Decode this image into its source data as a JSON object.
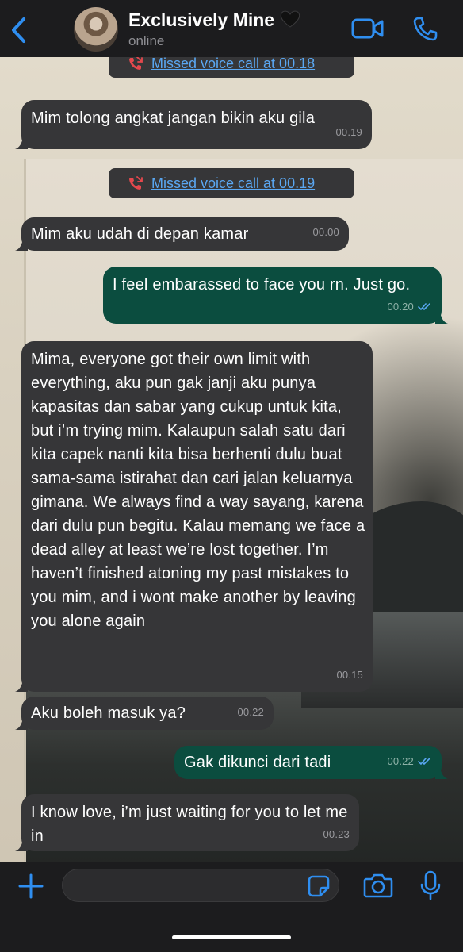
{
  "header": {
    "contact_name": "Exclusively Mine",
    "status": "online"
  },
  "messages": [
    {
      "type": "system",
      "text": "Missed voice call at 00.18"
    },
    {
      "type": "incoming",
      "text": "Mim tolong angkat jangan bikin aku gila",
      "time": "00.19"
    },
    {
      "type": "system",
      "text": "Missed voice call at 00.19"
    },
    {
      "type": "incoming",
      "text": "Mim aku udah di depan kamar",
      "time": "00.00"
    },
    {
      "type": "outgoing",
      "text": "I feel embarassed to face you rn. Just go.",
      "time": "00.20",
      "status": "read"
    },
    {
      "type": "incoming",
      "text": "Mima, everyone got their own limit with everything, aku pun gak janji aku punya kapasitas dan sabar yang cukup untuk kita, but i’m trying mim. Kalaupun salah satu dari kita capek nanti kita bisa berhenti dulu buat sama-sama istirahat dan cari jalan keluarnya gimana. We always find a way sayang, karena dari dulu pun begitu. Kalau memang we face a dead alley at least we’re lost together. I’m haven’t finished atoning my past mistakes to you mim, and i wont make another by leaving you alone again",
      "time": "00.15"
    },
    {
      "type": "incoming",
      "text": "Aku boleh masuk ya?",
      "time": "00.22"
    },
    {
      "type": "outgoing",
      "text": "Gak dikunci dari tadi",
      "time": "00.22",
      "status": "read"
    },
    {
      "type": "incoming",
      "text": "I know love, i’m just waiting for you to let me in",
      "time": "00.23"
    }
  ],
  "input": {
    "value": "",
    "placeholder": ""
  },
  "icons": {
    "back": "chevron-left-icon",
    "heart": "black-heart-icon",
    "video": "video-call-icon",
    "phone": "phone-icon",
    "missed_call": "missed-call-icon",
    "read": "double-check-icon",
    "plus": "plus-icon",
    "sticker": "sticker-icon",
    "camera": "camera-icon",
    "mic": "microphone-icon"
  },
  "colors": {
    "accent": "#2f8ef0",
    "incoming_bubble": "#363638",
    "outgoing_bubble": "#0b4d3f",
    "missed_call": "#e5484d",
    "link": "#5aa7f2"
  }
}
